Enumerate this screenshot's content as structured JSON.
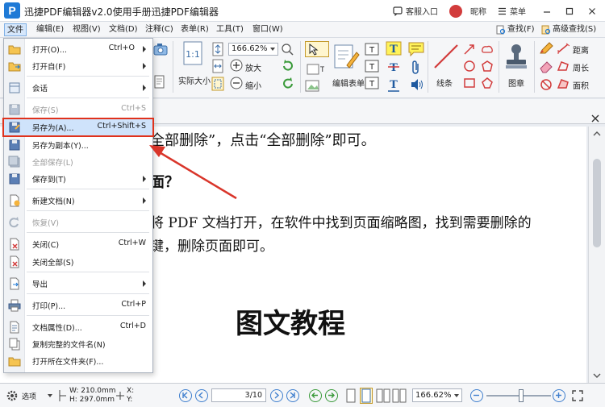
{
  "app": {
    "logo_letter": "P",
    "title": "迅捷PDF编辑器v2.0使用手册迅捷PDF编辑器"
  },
  "titlebar": {
    "support": "客服入口",
    "nickname": "昵称",
    "menu": "菜单"
  },
  "menubar": {
    "items": [
      "文件",
      "编辑(E)",
      "视图(V)",
      "文档(D)",
      "注释(C)",
      "表单(R)",
      "工具(T)",
      "窗口(W)"
    ],
    "find": "查找(F)",
    "advanced_find": "高级查找(S)"
  },
  "ribbon": {
    "actual_size": "实际大小",
    "zoom_value": "166.62%",
    "zoom_in": "放大",
    "zoom_out": "缩小",
    "edit_form": "编辑表单",
    "line": "线条",
    "stamp": "图章",
    "distance": "距离",
    "perimeter": "周长",
    "area": "面积"
  },
  "file_menu": {
    "items": [
      {
        "label": "打开(O)...",
        "shortcut": "Ctrl+O",
        "submenu": true,
        "disabled": false
      },
      {
        "label": "打开自(F)",
        "shortcut": "",
        "submenu": true,
        "disabled": false
      },
      {
        "label": "会话",
        "shortcut": "",
        "submenu": true,
        "disabled": false
      },
      {
        "label": "保存(S)",
        "shortcut": "Ctrl+S",
        "submenu": false,
        "disabled": true
      },
      {
        "label": "另存为(A)...",
        "shortcut": "Ctrl+Shift+S",
        "submenu": false,
        "disabled": false
      },
      {
        "label": "另存为副本(Y)...",
        "shortcut": "",
        "submenu": false,
        "disabled": false
      },
      {
        "label": "全部保存(L)",
        "shortcut": "",
        "submenu": false,
        "disabled": true
      },
      {
        "label": "保存到(T)",
        "shortcut": "",
        "submenu": true,
        "disabled": false
      },
      {
        "label": "新建文档(N)",
        "shortcut": "",
        "submenu": true,
        "disabled": false
      },
      {
        "label": "恢复(V)",
        "shortcut": "",
        "submenu": false,
        "disabled": true
      },
      {
        "label": "关闭(C)",
        "shortcut": "Ctrl+W",
        "submenu": false,
        "disabled": false
      },
      {
        "label": "关闭全部(S)",
        "shortcut": "",
        "submenu": false,
        "disabled": false
      },
      {
        "label": "导出",
        "shortcut": "",
        "submenu": true,
        "disabled": false
      },
      {
        "label": "打印(P)...",
        "shortcut": "Ctrl+P",
        "submenu": false,
        "disabled": false
      },
      {
        "label": "文档属性(D)...",
        "shortcut": "Ctrl+D",
        "submenu": false,
        "disabled": false
      },
      {
        "label": "复制完整的文件名(N)",
        "shortcut": "",
        "submenu": false,
        "disabled": false
      },
      {
        "label": "打开所在文件夹(F)...",
        "shortcut": "",
        "submenu": false,
        "disabled": false
      }
    ],
    "highlight_color": "#e0321c"
  },
  "document": {
    "line1": "全部删除”，点击“全部删除”即可。",
    "line2": "面？",
    "line3": "将 PDF 文档打开，在软件中找到页面缩略图，找到需要删除的",
    "line4": "键，删除页面即可。",
    "heading": "图文教程"
  },
  "statusbar": {
    "options": "选项",
    "width": "W: 210.0mm",
    "height": "H: 297.0mm",
    "x": "X:",
    "y": "Y:",
    "page": "3/10",
    "zoom": "166.62%"
  },
  "colors": {
    "accent": "#1f7ad6",
    "arrow": "#d9352a"
  }
}
